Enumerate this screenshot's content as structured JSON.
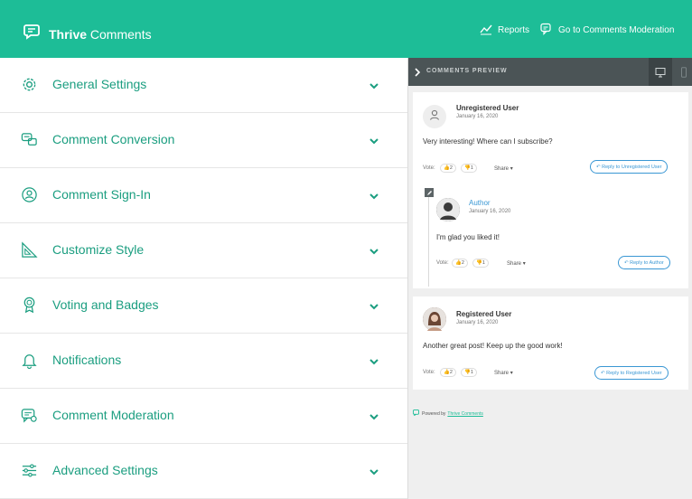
{
  "app": {
    "logo_bold": "Thrive",
    "logo_rest": " Comments",
    "nav": [
      {
        "label": "Reports",
        "icon": "chart-line-icon"
      },
      {
        "label": "Go to Comments Moderation",
        "icon": "comments-icon"
      }
    ]
  },
  "accordion": {
    "items": [
      {
        "label": "General Settings",
        "icon": "gear-icon"
      },
      {
        "label": "Comment Conversion",
        "icon": "comment-conversion-icon"
      },
      {
        "label": "Comment Sign-In",
        "icon": "user-circle-icon"
      },
      {
        "label": "Customize Style",
        "icon": "design-tools-icon"
      },
      {
        "label": "Voting and Badges",
        "icon": "badge-icon"
      },
      {
        "label": "Notifications",
        "icon": "bell-icon"
      },
      {
        "label": "Comment Moderation",
        "icon": "moderation-icon"
      },
      {
        "label": "Advanced Settings",
        "icon": "sliders-icon"
      }
    ]
  },
  "preview": {
    "title": "COMMENTS PREVIEW",
    "comment1": {
      "author": "Unregistered User",
      "date": "January 16, 2020",
      "text": "Very interesting! Where can I subscribe?",
      "vote_label": "Vote:",
      "up": "2",
      "down": "1",
      "share": "Share",
      "reply": "Reply to Unregistered User"
    },
    "reply1": {
      "author": "Author",
      "date": "January 16, 2020",
      "text": "I'm glad you liked it!",
      "vote_label": "Vote:",
      "up": "2",
      "down": "1",
      "share": "Share",
      "reply": "Reply to Author"
    },
    "comment2": {
      "author": "Registered User",
      "date": "January 16, 2020",
      "text": "Another great post! Keep up the good work!",
      "vote_label": "Vote:",
      "up": "2",
      "down": "1",
      "share": "Share",
      "reply": "Reply to Registered User"
    },
    "powered_prefix": "Powered by",
    "powered_link": "Thrive Comments"
  },
  "colors": {
    "brand": "#1dbd97",
    "label_green": "#1b9e80",
    "preview_bar": "#4b5456",
    "link_blue": "#3a97d4"
  }
}
